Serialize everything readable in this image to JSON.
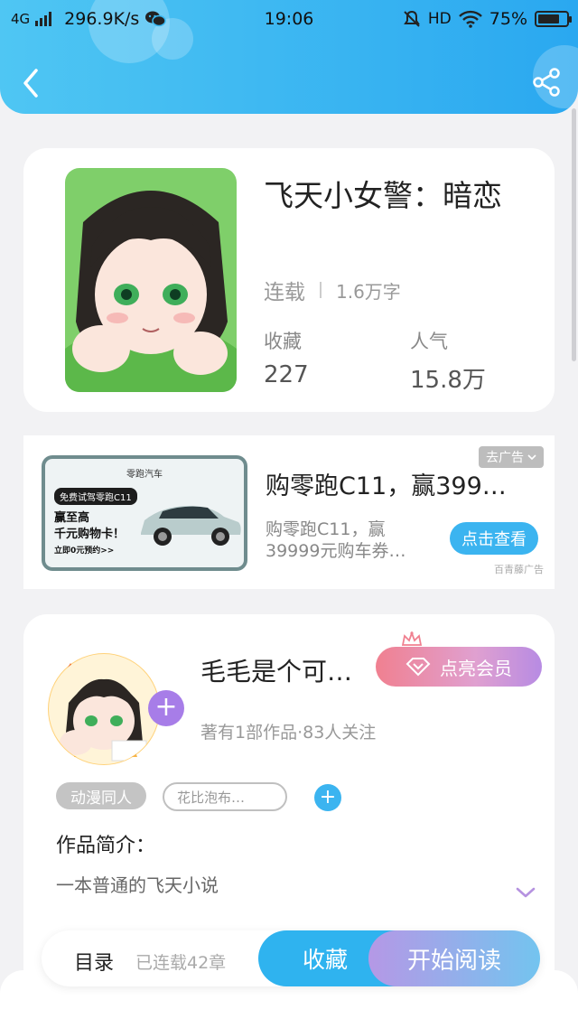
{
  "status_bar": {
    "network": "4G",
    "speed": "296.9K/s",
    "time": "19:06",
    "hd": "HD",
    "battery": "75%",
    "battery_level": 0.75
  },
  "book": {
    "title": "飞天小女警：暗恋",
    "status": "连载",
    "word_count": "1.6万字",
    "favorites_label": "收藏",
    "favorites_value": "227",
    "popularity_label": "人气",
    "popularity_value": "15.8万"
  },
  "ad": {
    "image_brand": "零跑汽车",
    "image_tag": "免费试驾零跑C11",
    "image_line1": "赢至高",
    "image_line2": "千元购物卡！",
    "image_line3": "立即0元预约>>",
    "title": "购零跑C11，赢399…",
    "description": "购零跑C11，赢39999元购车券…",
    "close_label": "去广告",
    "cta_label": "点击查看",
    "source": "百青藤广告"
  },
  "author": {
    "name": "毛毛是个可…",
    "vip_label": "点亮会员",
    "stats": "著有1部作品·83人关注",
    "tags": [
      "动漫同人",
      "花比泡布…"
    ],
    "intro_label": "作品简介：",
    "intro_text": "一本普通的飞天小说"
  },
  "bottom_bar": {
    "toc_label": "目录",
    "toc_count": "已连载42章",
    "collect_label": "收藏",
    "read_label": "开始阅读"
  },
  "colors": {
    "header_start": "#4fc6f3",
    "header_end": "#2aa8f0",
    "accent_blue": "#3bb4f0",
    "vip_purple": "#a77de8"
  },
  "icons": [
    "back-icon",
    "share-icon",
    "signal-icon",
    "wechat-icon",
    "mute-icon",
    "wifi-icon",
    "battery-icon",
    "plus-icon",
    "diamond-icon",
    "crown-icon",
    "chevron-down-icon"
  ]
}
